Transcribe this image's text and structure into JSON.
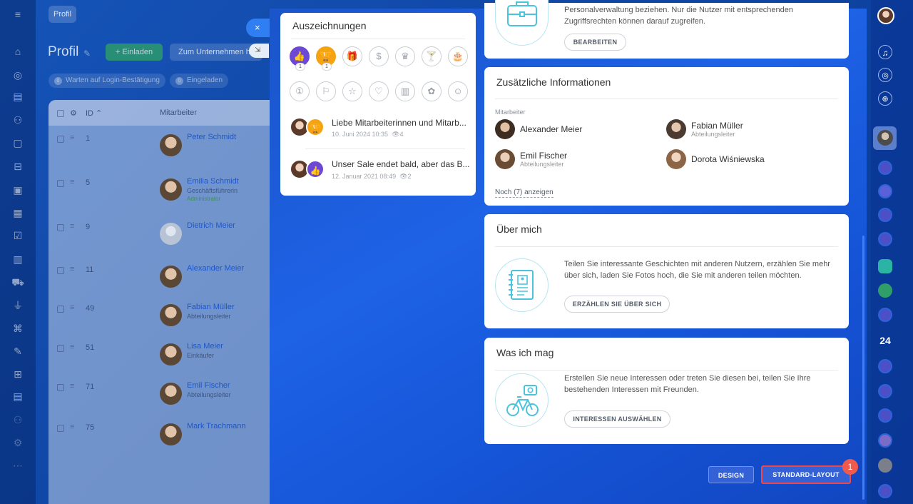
{
  "background": {
    "breadcrumb": "Profil",
    "page_title": "Profil",
    "invite_button": "+ Einladen",
    "company_button": "Zum Unternehmen h",
    "filters": [
      {
        "count": "0",
        "label": "Warten auf Login-Bestätigung"
      },
      {
        "count": "0",
        "label": "Eingeladen"
      }
    ],
    "grid": {
      "col_id": "ID ⌃",
      "col_employee": "Mitarbeiter",
      "rows": [
        {
          "id": "1",
          "name": "Peter Schmidt",
          "role": "",
          "role2": "",
          "avatar": "photo"
        },
        {
          "id": "5",
          "name": "Emilia Schmidt",
          "role": "Geschäftsführerin",
          "role2": "Administrator",
          "avatar": "photo"
        },
        {
          "id": "9",
          "name": "Dietrich Meier",
          "role": "",
          "role2": "",
          "avatar": "gray"
        },
        {
          "id": "11",
          "name": "Alexander Meier",
          "role": "",
          "role2": "",
          "avatar": "photo"
        },
        {
          "id": "49",
          "name": "Fabian Müller",
          "role": "Abteilungsleiter",
          "role2": "",
          "avatar": "photo"
        },
        {
          "id": "51",
          "name": "Lisa Meier",
          "role": "Einkäufer",
          "role2": "",
          "avatar": "photo"
        },
        {
          "id": "71",
          "name": "Emil Fischer",
          "role": "Abteilungsleiter",
          "role2": "",
          "avatar": "photo"
        },
        {
          "id": "75",
          "name": "Mark Trachmann",
          "role": "",
          "role2": "",
          "avatar": "photo"
        }
      ]
    }
  },
  "slider": {
    "close_icon": "×",
    "awards": {
      "title": "Auszeichnungen",
      "badges_row1": [
        {
          "icon": "thumbs-up-icon",
          "glyph": "👍",
          "count": "1",
          "style": "filled-purple"
        },
        {
          "icon": "trophy-icon",
          "glyph": "🏆",
          "count": "1",
          "style": "filled-orange"
        },
        {
          "icon": "gift-icon",
          "glyph": "🎁",
          "count": "",
          "style": ""
        },
        {
          "icon": "money-bag-icon",
          "glyph": "$",
          "count": "",
          "style": ""
        },
        {
          "icon": "crown-icon",
          "glyph": "♛",
          "count": "",
          "style": ""
        },
        {
          "icon": "cocktail-icon",
          "glyph": "🍸",
          "count": "",
          "style": ""
        },
        {
          "icon": "cake-icon",
          "glyph": "🎂",
          "count": "",
          "style": ""
        }
      ],
      "badges_row2": [
        {
          "icon": "number-one-icon",
          "glyph": "①"
        },
        {
          "icon": "flag-icon",
          "glyph": "⚐"
        },
        {
          "icon": "star-icon",
          "glyph": "☆"
        },
        {
          "icon": "heart-icon",
          "glyph": "♡"
        },
        {
          "icon": "beer-icon",
          "glyph": "▥"
        },
        {
          "icon": "flower-icon",
          "glyph": "✿"
        },
        {
          "icon": "smiley-icon",
          "glyph": "☺"
        }
      ],
      "posts": [
        {
          "title": "Liebe Mitarbeiterinnen und Mitarb...",
          "date": "10. Juni 2024 10:35",
          "views": "4",
          "badge": "trophy"
        },
        {
          "title": "Unser Sale endet bald, aber das B...",
          "date": "12. Januar 2021 08:49",
          "views": "2",
          "badge": "thumbs-up"
        }
      ]
    },
    "personnel": {
      "text_line1": "Personalverwaltung beziehen. Nur die Nutzer mit entsprechenden",
      "text_line2": "Zugriffsrechten können darauf zugreifen.",
      "button": "BEARBEITEN"
    },
    "additional_info": {
      "title": "Zusätzliche Informationen",
      "section_label": "Mitarbeiter",
      "employees": [
        {
          "name": "Alexander Meier",
          "role": ""
        },
        {
          "name": "Fabian Müller",
          "role": "Abteilungsleiter"
        },
        {
          "name": "Emil Fischer",
          "role": "Abteilungsleiter"
        },
        {
          "name": "Dorota Wiśniewska",
          "role": ""
        }
      ],
      "more_link": "Noch (7) anzeigen"
    },
    "about_me": {
      "title": "Über mich",
      "text_line1": "Teilen Sie interessante Geschichten mit anderen Nutzern, erzählen Sie mehr",
      "text_line2": "über sich, laden Sie Fotos hoch, die Sie mit anderen teilen möchten.",
      "button": "ERZÄHLEN SIE ÜBER SICH"
    },
    "likes": {
      "title": "Was ich mag",
      "text_line1": "Erstellen Sie neue Interessen oder treten Sie diesen bei, teilen Sie Ihre",
      "text_line2": "bestehenden Interessen mit Freunden.",
      "button": "INTERESSEN AUSWÄHLEN"
    },
    "footer": {
      "design_button": "DESIGN",
      "standard_layout_button": "STANDARD-LAYOUT",
      "step_marker": "1"
    }
  },
  "right_rail": {
    "counter": "24"
  },
  "colors": {
    "accent": "#2f7ef2",
    "primary_button": "#3461d6",
    "highlight": "#f0474b"
  }
}
